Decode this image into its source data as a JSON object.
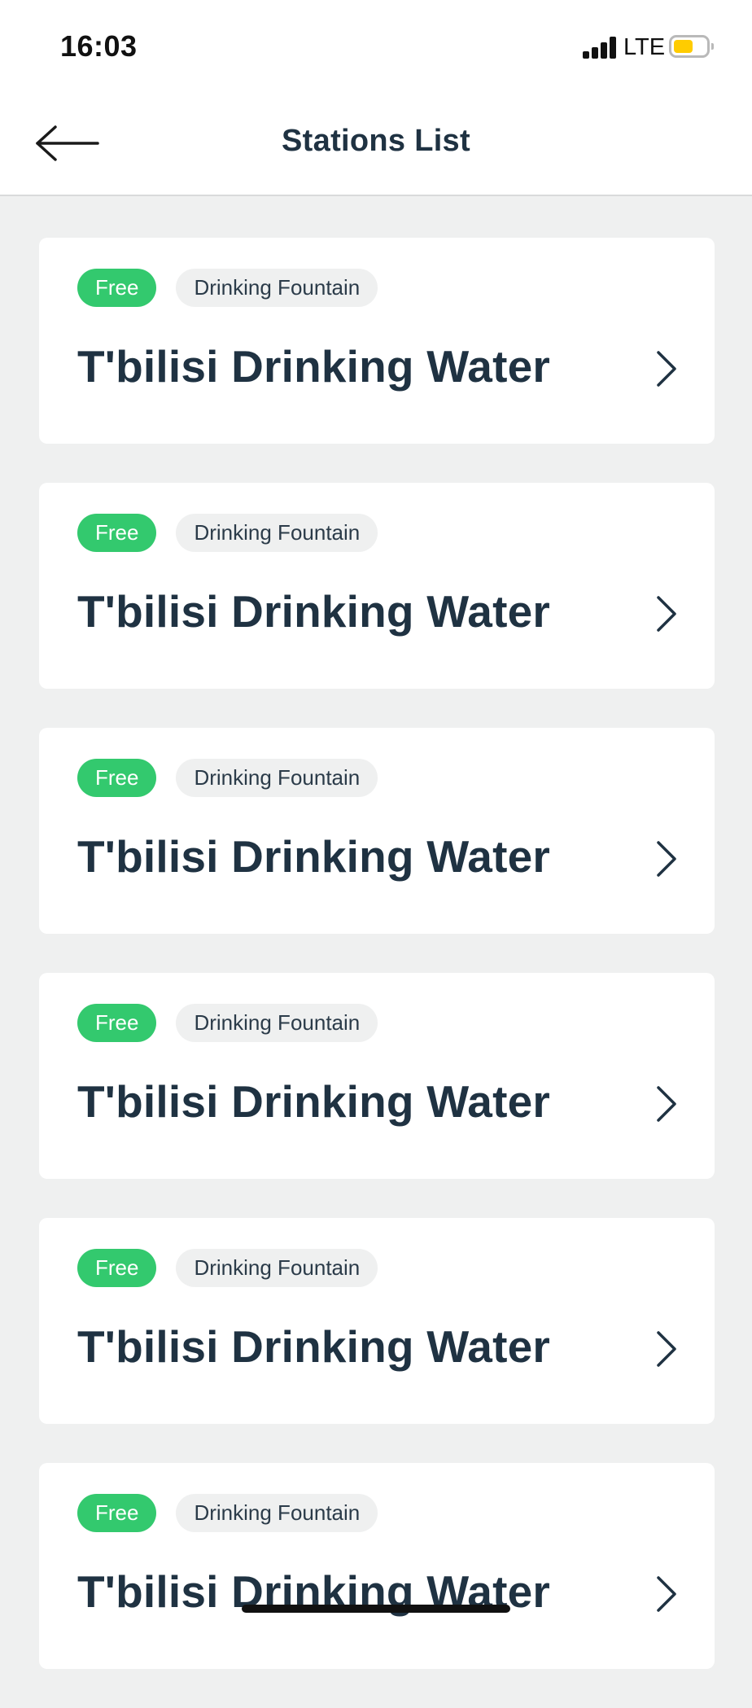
{
  "status_bar": {
    "time": "16:03",
    "network": "LTE",
    "battery_color": "#ffcc00",
    "battery_level": 0.6
  },
  "header": {
    "title": "Stations List",
    "back_icon": "arrow-left-icon"
  },
  "stations": [
    {
      "price": "Free",
      "type": "Drinking Fountain",
      "name": "T'bilisi Drinking Water"
    },
    {
      "price": "Free",
      "type": "Drinking Fountain",
      "name": "T'bilisi Drinking Water"
    },
    {
      "price": "Free",
      "type": "Drinking Fountain",
      "name": "T'bilisi Drinking Water"
    },
    {
      "price": "Free",
      "type": "Drinking Fountain",
      "name": "T'bilisi Drinking Water"
    },
    {
      "price": "Free",
      "type": "Drinking Fountain",
      "name": "T'bilisi Drinking Water"
    },
    {
      "price": "Free",
      "type": "Drinking Fountain",
      "name": "T'bilisi Drinking Water"
    }
  ],
  "colors": {
    "accent_green": "#33c96e",
    "text_dark": "#1f3242",
    "background": "#eff0f0"
  }
}
